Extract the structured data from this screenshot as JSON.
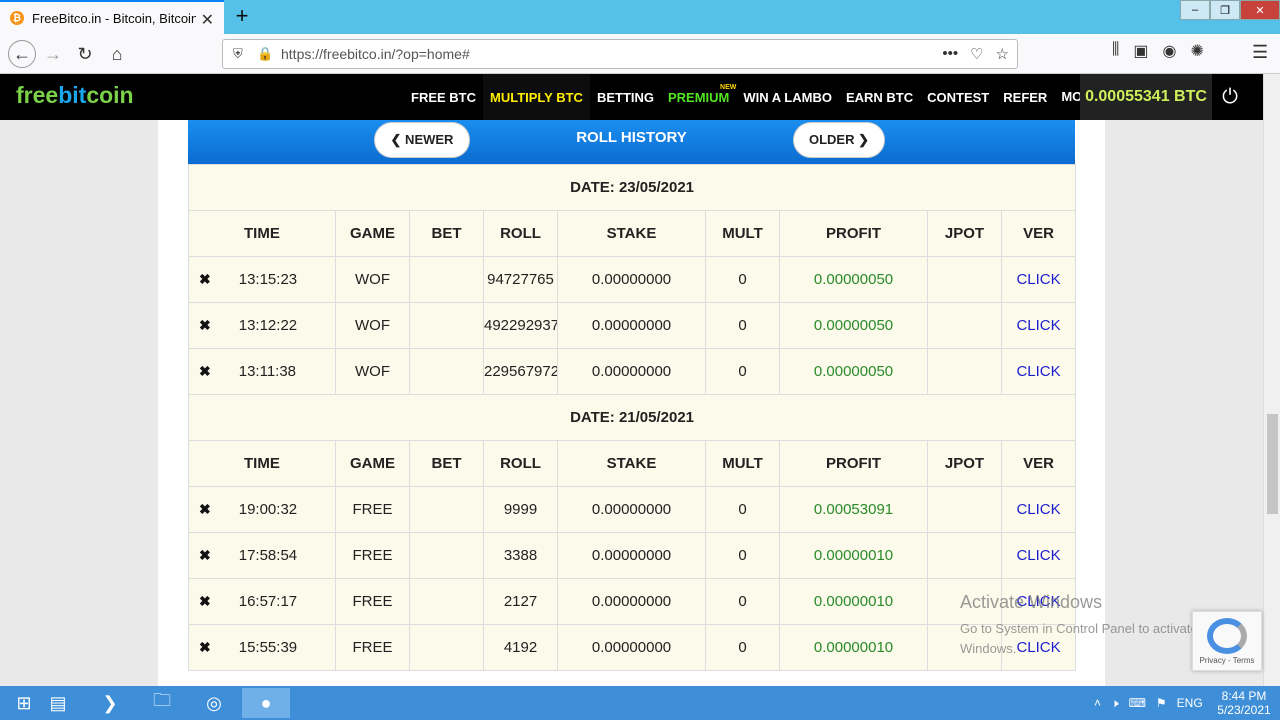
{
  "browser": {
    "tab_title": "FreeBitco.in - Bitcoin, Bitcoin Pr",
    "new_tab_symbol": "+",
    "url": "https://freebitco.in/?op=home#",
    "more_dots": "•••"
  },
  "site": {
    "logo_free": "free",
    "logo_bit": "bit",
    "logo_coin": "coin",
    "menu": [
      {
        "label": "FREE BTC"
      },
      {
        "label": "MULTIPLY BTC"
      },
      {
        "label": "BETTING"
      },
      {
        "label": "PREMIUM",
        "badge": "NEW"
      },
      {
        "label": "WIN A LAMBO"
      },
      {
        "label": "EARN BTC"
      },
      {
        "label": "CONTEST"
      },
      {
        "label": "REFER"
      },
      {
        "label": "MORE ⌄"
      }
    ],
    "balance": "0.00055341 BTC"
  },
  "history": {
    "title": "ROLL HISTORY",
    "newer_label": "❮ NEWER",
    "older_label": "OLDER ❯",
    "columns": [
      "TIME",
      "GAME",
      "BET",
      "ROLL",
      "STAKE",
      "MULT",
      "PROFIT",
      "JPOT",
      "VER"
    ],
    "groups": [
      {
        "date": "DATE: 23/05/2021",
        "rows": [
          {
            "time": "13:15:23",
            "game": "WOF",
            "bet": "",
            "roll": "94727765",
            "stake": "0.00000000",
            "mult": "0",
            "profit": "0.00000050",
            "jpot": "",
            "ver": "CLICK"
          },
          {
            "time": "13:12:22",
            "game": "WOF",
            "bet": "",
            "roll": "492292937",
            "stake": "0.00000000",
            "mult": "0",
            "profit": "0.00000050",
            "jpot": "",
            "ver": "CLICK"
          },
          {
            "time": "13:11:38",
            "game": "WOF",
            "bet": "",
            "roll": "229567972",
            "stake": "0.00000000",
            "mult": "0",
            "profit": "0.00000050",
            "jpot": "",
            "ver": "CLICK"
          }
        ]
      },
      {
        "date": "DATE: 21/05/2021",
        "rows": [
          {
            "time": "19:00:32",
            "game": "FREE",
            "bet": "",
            "roll": "9999",
            "stake": "0.00000000",
            "mult": "0",
            "profit": "0.00053091",
            "jpot": "",
            "ver": "CLICK"
          },
          {
            "time": "17:58:54",
            "game": "FREE",
            "bet": "",
            "roll": "3388",
            "stake": "0.00000000",
            "mult": "0",
            "profit": "0.00000010",
            "jpot": "",
            "ver": "CLICK"
          },
          {
            "time": "16:57:17",
            "game": "FREE",
            "bet": "",
            "roll": "2127",
            "stake": "0.00000000",
            "mult": "0",
            "profit": "0.00000010",
            "jpot": "",
            "ver": "CLICK"
          },
          {
            "time": "15:55:39",
            "game": "FREE",
            "bet": "",
            "roll": "4192",
            "stake": "0.00000000",
            "mult": "0",
            "profit": "0.00000010",
            "jpot": "",
            "ver": "CLICK"
          }
        ]
      }
    ]
  },
  "overlay": {
    "activate_title": "Activate Windows",
    "activate_sub": "Go to System in Control Panel to activate Windows.",
    "recaptcha_text": "Privacy - Terms"
  },
  "taskbar": {
    "lang": "ENG",
    "time": "8:44 PM",
    "date": "5/23/2021"
  },
  "colors": {
    "header_bg": "#000000",
    "active_menu": "#ffee00",
    "premium": "#51e51f",
    "profit": "#2a8a2a",
    "link": "#1c1cd0",
    "history_bar": "#1a8ef0"
  }
}
